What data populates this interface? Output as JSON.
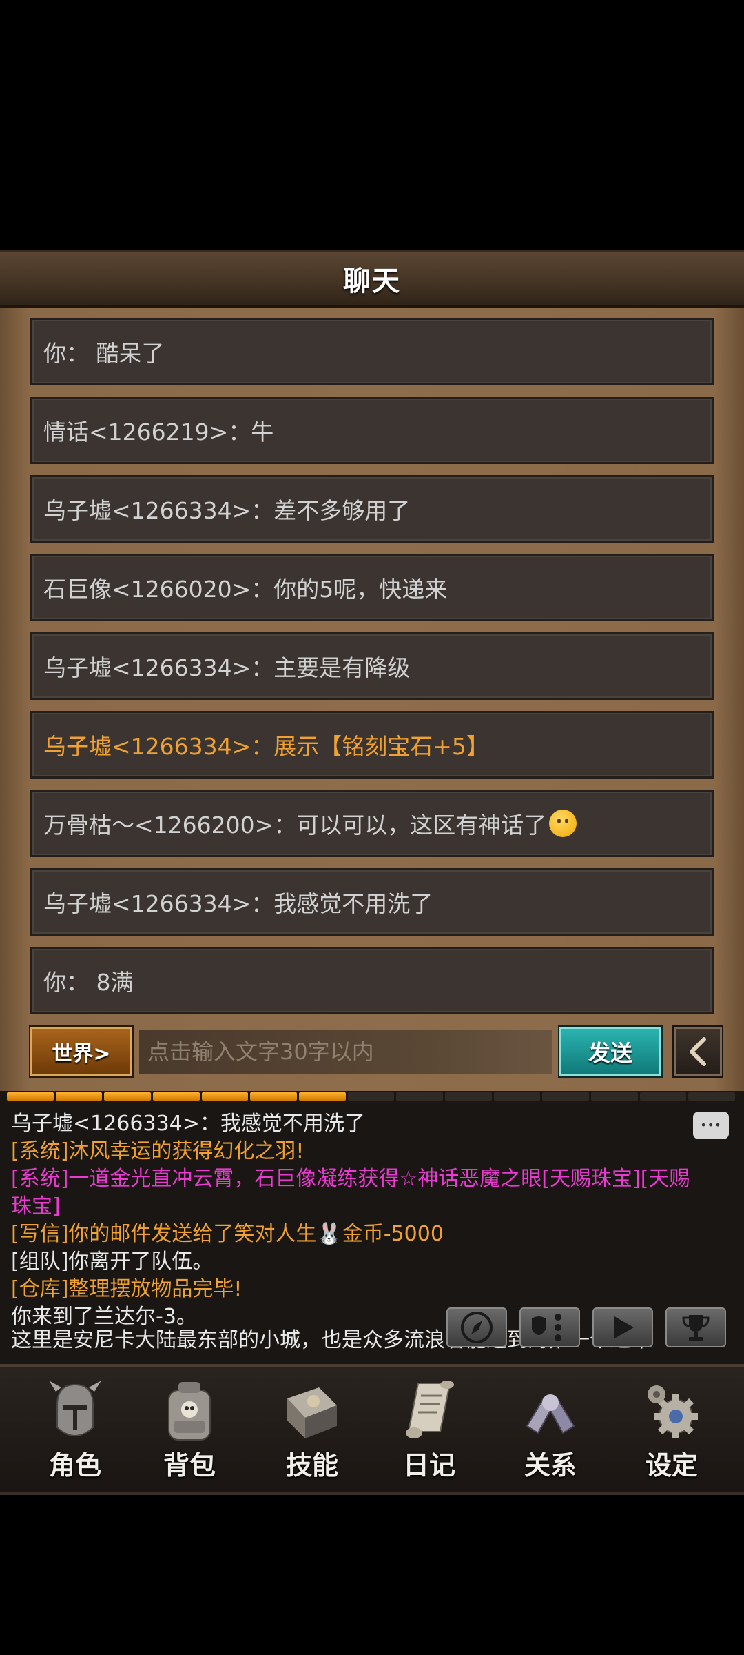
{
  "title": "聊天",
  "messages": [
    {
      "text": "你：  酷呆了",
      "highlight": false
    },
    {
      "text": "情话<1266219>：牛",
      "highlight": false
    },
    {
      "text": "乌子墟<1266334>：差不多够用了",
      "highlight": false
    },
    {
      "text": "石巨像<1266020>：你的5呢，快递来",
      "highlight": false
    },
    {
      "text": "乌子墟<1266334>：主要是有降级",
      "highlight": false
    },
    {
      "text": "乌子墟<1266334>：展示【铭刻宝石+5】",
      "highlight": true
    },
    {
      "text": "万骨枯～<1266200>：可以可以，这区有神话了",
      "highlight": false,
      "emoji": "thinking-face"
    },
    {
      "text": "乌子墟<1266334>：我感觉不用洗了",
      "highlight": false
    },
    {
      "text": "你：  8满",
      "highlight": false
    }
  ],
  "input": {
    "channel_label": "世界>",
    "placeholder": "点击输入文字30字以内",
    "send_label": "发送",
    "back_icon": "chevron-left-icon"
  },
  "progress": {
    "filled_segments": 7,
    "total_segments": 15
  },
  "log": {
    "lines": [
      {
        "text": "乌子墟<1266334>：我感觉不用洗了",
        "color": "#e8e8e8"
      },
      {
        "text": "[系统]沐风幸运的获得幻化之羽!",
        "color": "#f0a130"
      },
      {
        "text": "[系统]一道金光直冲云霄，石巨像凝练获得☆神话恶魔之眼[天赐珠宝][天赐珠宝]",
        "color": "#e83bd0"
      },
      {
        "text": "[写信]你的邮件发送给了笑对人生🐰金币-5000",
        "color": "#f0a130"
      },
      {
        "text": "[组队]你离开了队伍。",
        "color": "#e8e8e8"
      },
      {
        "text": "[仓库]整理摆放物品完毕!",
        "color": "#f0a130"
      },
      {
        "text": "你来到了兰达尔-3。",
        "color": "#e8e8e8"
      },
      {
        "text": "这里是安尼卡大陆最东部的小城，也是众多流浪者能遇到的第一个避难",
        "color": "#e8e8e8"
      }
    ],
    "quick_buttons": [
      "compass-icon",
      "settings-toggle-icon",
      "play-icon",
      "trophy-icon"
    ]
  },
  "nav": [
    {
      "label": "角色",
      "icon": "helmet-icon"
    },
    {
      "label": "背包",
      "icon": "backpack-icon"
    },
    {
      "label": "技能",
      "icon": "spellbook-icon"
    },
    {
      "label": "日记",
      "icon": "scroll-icon"
    },
    {
      "label": "关系",
      "icon": "handshake-icon"
    },
    {
      "label": "设定",
      "icon": "gear-icon"
    }
  ],
  "colors": {
    "highlight": "#f0a130",
    "system_magenta": "#e83bd0",
    "send_teal": "#1a9a98",
    "channel_orange": "#a8641c"
  }
}
